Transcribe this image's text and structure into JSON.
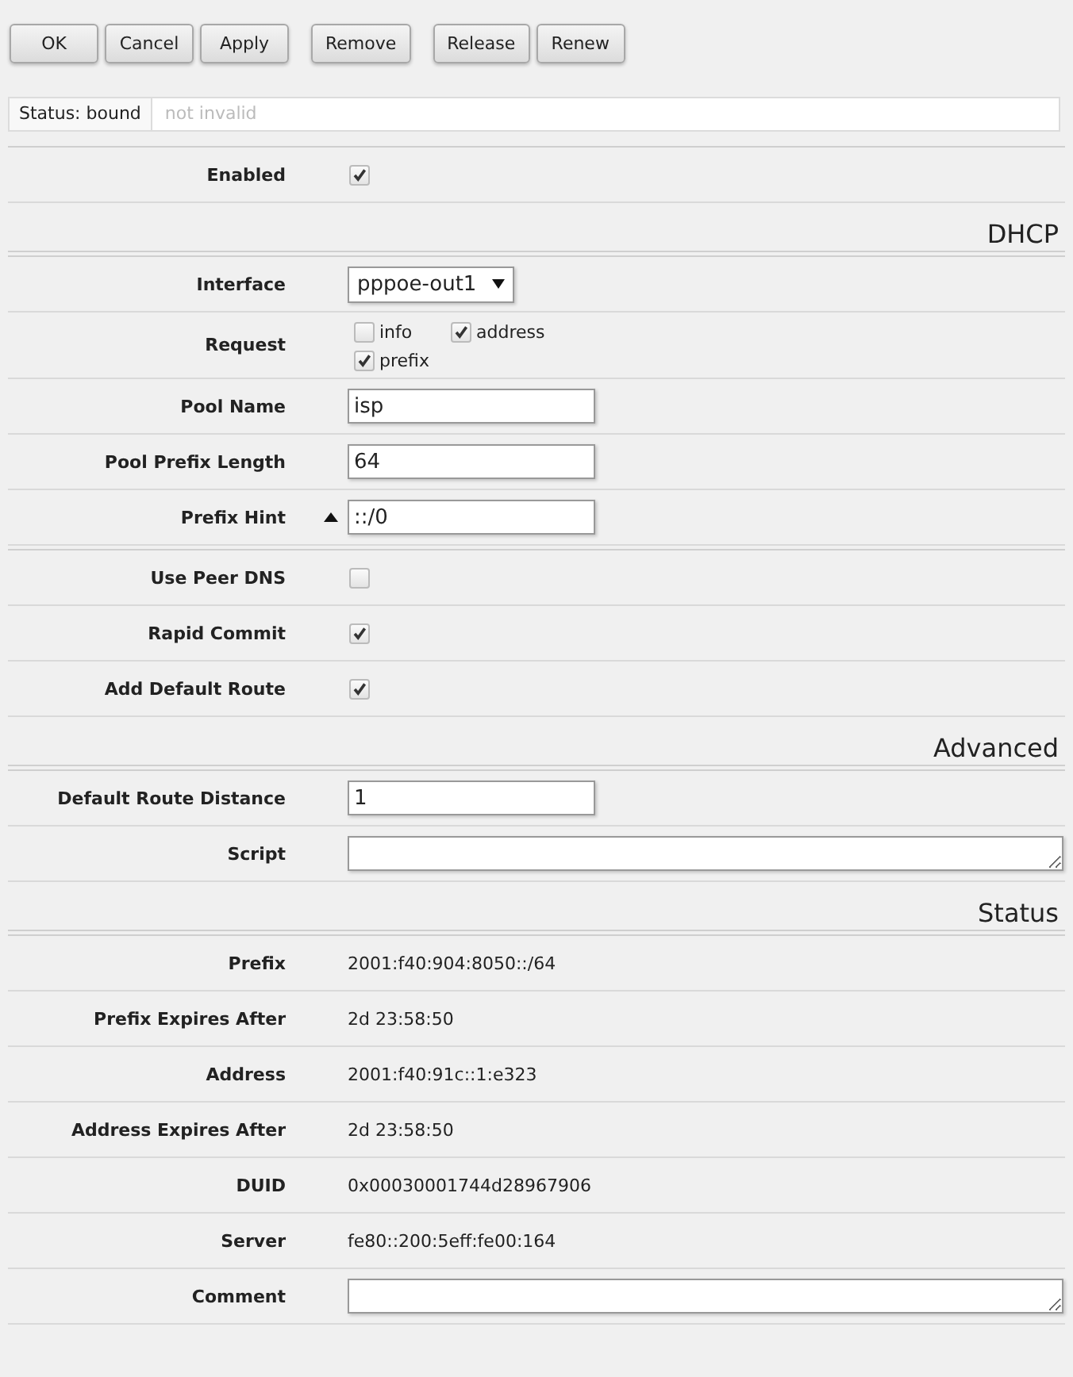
{
  "toolbar": {
    "groups": [
      {
        "buttons": [
          "OK",
          "Cancel",
          "Apply"
        ]
      },
      {
        "buttons": [
          "Remove"
        ]
      },
      {
        "buttons": [
          "Release",
          "Renew"
        ]
      }
    ]
  },
  "status": {
    "label": "Status: bound",
    "message": "not invalid"
  },
  "sections": [
    {
      "rows": [
        {
          "kind": "checkbox",
          "label": "Enabled",
          "checked": true
        }
      ]
    },
    {
      "title": "DHCP",
      "rows": [
        {
          "kind": "select",
          "label": "Interface",
          "value": "pppoe-out1"
        },
        {
          "kind": "checkgroup",
          "label": "Request",
          "options": [
            {
              "label": "info",
              "checked": false
            },
            {
              "label": "address",
              "checked": true
            },
            {
              "label": "prefix",
              "checked": true
            }
          ]
        },
        {
          "kind": "text",
          "label": "Pool Name",
          "value": "isp"
        },
        {
          "kind": "text",
          "label": "Pool Prefix Length",
          "value": "64"
        },
        {
          "kind": "text",
          "label": "Prefix Hint",
          "value": "::/0",
          "collapsible": true
        }
      ]
    },
    {
      "rows": [
        {
          "kind": "checkbox",
          "label": "Use Peer DNS",
          "checked": false
        },
        {
          "kind": "checkbox",
          "label": "Rapid Commit",
          "checked": true
        },
        {
          "kind": "checkbox",
          "label": "Add Default Route",
          "checked": true
        }
      ]
    },
    {
      "title": "Advanced",
      "rows": [
        {
          "kind": "text",
          "label": "Default Route Distance",
          "value": "1"
        },
        {
          "kind": "textarea",
          "label": "Script"
        }
      ]
    },
    {
      "title": "Status",
      "rows": [
        {
          "kind": "value",
          "label": "Prefix",
          "value": "2001:f40:904:8050::/64"
        },
        {
          "kind": "value",
          "label": "Prefix Expires After",
          "value": "2d 23:58:50"
        },
        {
          "kind": "value",
          "label": "Address",
          "value": "2001:f40:91c::1:e323"
        },
        {
          "kind": "value",
          "label": "Address Expires After",
          "value": "2d 23:58:50"
        },
        {
          "kind": "value",
          "label": "DUID",
          "value": "0x00030001744d28967906"
        },
        {
          "kind": "value",
          "label": "Server",
          "value": "fe80::200:5eff:fe00:164"
        },
        {
          "kind": "textarea",
          "label": "Comment"
        }
      ]
    }
  ]
}
